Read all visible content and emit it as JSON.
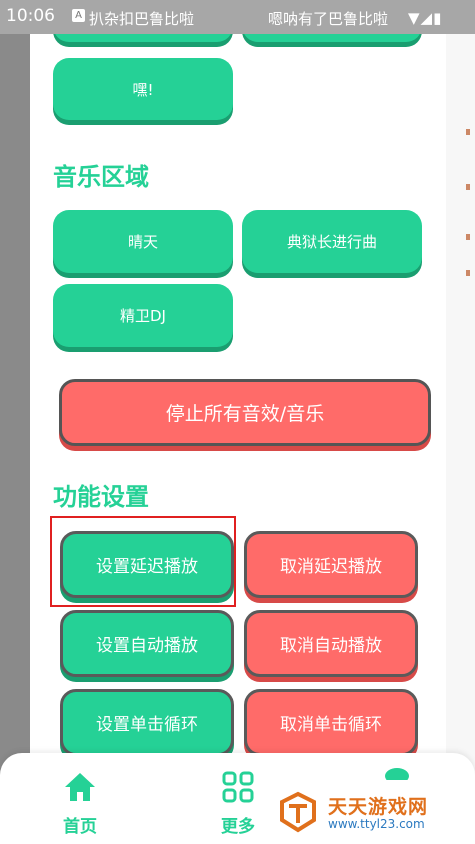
{
  "status_bar": {
    "time": "10:06",
    "app_title": "扒杂扣巴鲁比啦",
    "right_title": "嗯呐有了巴鲁比啦",
    "icons": "▼◢▮"
  },
  "top_partial_buttons": [
    "",
    ""
  ],
  "hey_button": "嘿!",
  "music_section": {
    "title": "音乐区域",
    "buttons": [
      "晴天",
      "典狱长进行曲",
      "精卫DJ"
    ]
  },
  "stop_button": "停止所有音效/音乐",
  "function_section": {
    "title": "功能设置",
    "rows": [
      {
        "set": "设置延迟播放",
        "cancel": "取消延迟播放"
      },
      {
        "set": "设置自动播放",
        "cancel": "取消自动播放"
      },
      {
        "set": "设置单击循环",
        "cancel": "取消单击循环"
      }
    ]
  },
  "bottom_nav": {
    "items": [
      {
        "label": "首页",
        "icon": "home-icon"
      },
      {
        "label": "更多",
        "icon": "grid-icon"
      },
      {
        "label": "",
        "icon": "profile-icon"
      }
    ]
  },
  "watermark": {
    "title": "天天游戏网",
    "url": "www.ttyl23.com"
  },
  "colors": {
    "accent_green": "#25d196",
    "danger_red": "#ff6b69",
    "highlight_border": "#e02020"
  }
}
